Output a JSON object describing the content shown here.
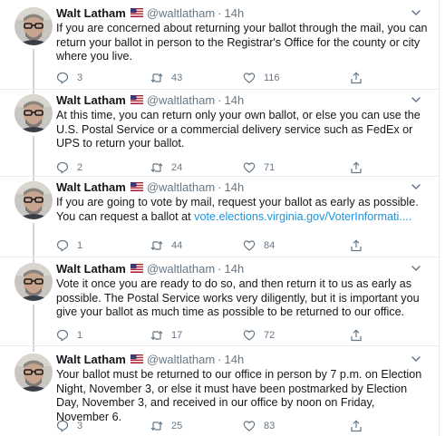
{
  "tweets": [
    {
      "name": "Walt Latham",
      "handle": "@waltlatham",
      "separator": "·",
      "time": "14h",
      "text": "If you are concerned about returning your ballot through the mail, you can return your ballot in person to the Registrar's Office for the county or city where you live.",
      "link": "",
      "replies": "3",
      "retweets": "43",
      "likes": "116"
    },
    {
      "name": "Walt Latham",
      "handle": "@waltlatham",
      "separator": "·",
      "time": "14h",
      "text": "At this time, you can return only your own ballot, or else you can use the U.S. Postal Service or a commercial delivery service such as FedEx or UPS to return your ballot.",
      "link": "",
      "replies": "2",
      "retweets": "24",
      "likes": "71"
    },
    {
      "name": "Walt Latham",
      "handle": "@waltlatham",
      "separator": "·",
      "time": "14h",
      "text": "If you are going to vote by mail, request your ballot as early as possible. You can request a ballot at ",
      "link": "vote.elections.virginia.gov/VoterInformati....",
      "replies": "1",
      "retweets": "44",
      "likes": "84"
    },
    {
      "name": "Walt Latham",
      "handle": "@waltlatham",
      "separator": "·",
      "time": "14h",
      "text": "Vote it once you are ready to do so, and then return it to us as early as possible. The Postal Service works very diligently, but it is important you give your ballot as much time as possible to be returned to our office.",
      "link": "",
      "replies": "1",
      "retweets": "17",
      "likes": "72"
    },
    {
      "name": "Walt Latham",
      "handle": "@waltlatham",
      "separator": "·",
      "time": "14h",
      "text": "Your ballot must be returned to our office in person by 7 p.m. on Election Night, November 3, or else it must have been postmarked by Election Day, November 3, and received in our office by noon on Friday, November 6.",
      "link": "",
      "replies": "3",
      "retweets": "25",
      "likes": "83"
    }
  ],
  "icons": {
    "reply": "reply-icon",
    "retweet": "retweet-icon",
    "like": "heart-icon",
    "share": "share-icon",
    "menu": "chevron-down-icon",
    "flag": "us-flag-icon"
  },
  "colors": {
    "text": "#14171a",
    "secondary": "#657786",
    "link": "#1b95e0",
    "divider": "#e6ecf0",
    "thread_line": "#ccd6dd"
  }
}
